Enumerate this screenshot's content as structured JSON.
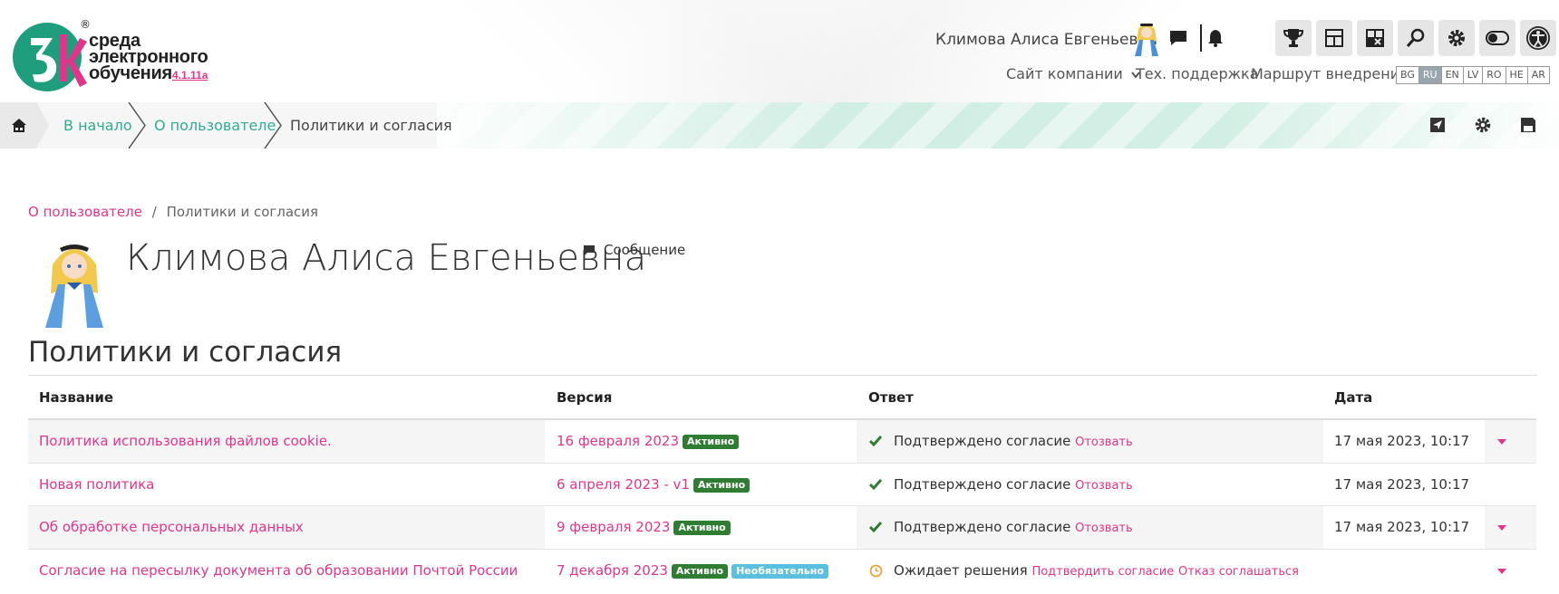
{
  "brand": {
    "name_line1": "среда",
    "name_line2": "электронного",
    "name_line3": "обучения",
    "version": "4.1.11a",
    "reg": "®"
  },
  "header": {
    "user_name": "Климова Алиса Евгеньевна",
    "nav": [
      "Сайт компании",
      "Тех. поддержка",
      "Маршрут внедрения"
    ],
    "languages": [
      "BG",
      "RU",
      "EN",
      "LV",
      "RO",
      "HE",
      "AR"
    ],
    "active_language": "RU"
  },
  "breadcrumb": {
    "items": [
      "В начало",
      "О пользователе",
      "Политики и согласия"
    ]
  },
  "page": {
    "path_link": "О пользователе",
    "path_sep": "/",
    "path_current": "Политики и согласия",
    "profile_name": "Климова Алиса Евгеньевна",
    "message_label": "Сообщение",
    "section_title": "Политики и согласия"
  },
  "table": {
    "headers": [
      "Название",
      "Версия",
      "Ответ",
      "Дата"
    ],
    "rows": [
      {
        "name": "Политика использования файлов cookie.",
        "version": "16 февраля 2023",
        "badges": [
          "Активно"
        ],
        "status": "Подтверждено согласие",
        "actions": [
          "Отозвать"
        ],
        "date": "17 мая 2023, 10:17"
      },
      {
        "name": "Новая политика",
        "version": "6 апреля 2023 - v1",
        "badges": [
          "Активно"
        ],
        "status": "Подтверждено согласие",
        "actions": [
          "Отозвать"
        ],
        "date": "17 мая 2023, 10:17"
      },
      {
        "name": "Об обработке персональных данных",
        "version": "9 февраля 2023",
        "badges": [
          "Активно"
        ],
        "status": "Подтверждено согласие",
        "actions": [
          "Отозвать"
        ],
        "date": "17 мая 2023, 10:17"
      },
      {
        "name": "Согласие на пересылку документа об образовании Почтой России",
        "version": "7 декабря 2023",
        "badges": [
          "Активно",
          "Необязательно"
        ],
        "status": "Ожидает решения",
        "actions": [
          "Подтвердить согласие",
          "Отказ соглашаться"
        ],
        "date": ""
      }
    ]
  },
  "colors": {
    "accent_pink": "#e0358b",
    "accent_teal": "#2fae8e",
    "badge_green": "#2e7d32",
    "badge_blue": "#5bc0de"
  }
}
